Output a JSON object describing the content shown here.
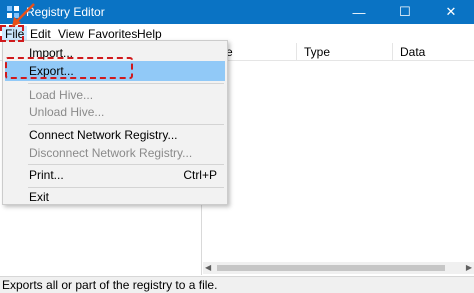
{
  "window": {
    "title": "Registry Editor",
    "controls": [
      "—",
      "☐",
      "✕"
    ]
  },
  "menubar": {
    "items": [
      "File",
      "Edit",
      "View",
      "Favorites",
      "Help"
    ]
  },
  "columns": {
    "name_partial": "e",
    "type": "Type",
    "data": "Data"
  },
  "file_menu": {
    "import": "Import...",
    "export": "Export...",
    "load_hive": "Load Hive...",
    "unload_hive": "Unload Hive...",
    "connect": "Connect Network Registry...",
    "disconnect": "Disconnect Network Registry...",
    "print": "Print...",
    "print_shortcut": "Ctrl+P",
    "exit": "Exit"
  },
  "statusbar": {
    "text": "Exports all or part of the registry to a file."
  },
  "colors": {
    "titlebar": "#0a73c4",
    "highlight": "#91c9f7",
    "annotation": "#d0191c"
  }
}
